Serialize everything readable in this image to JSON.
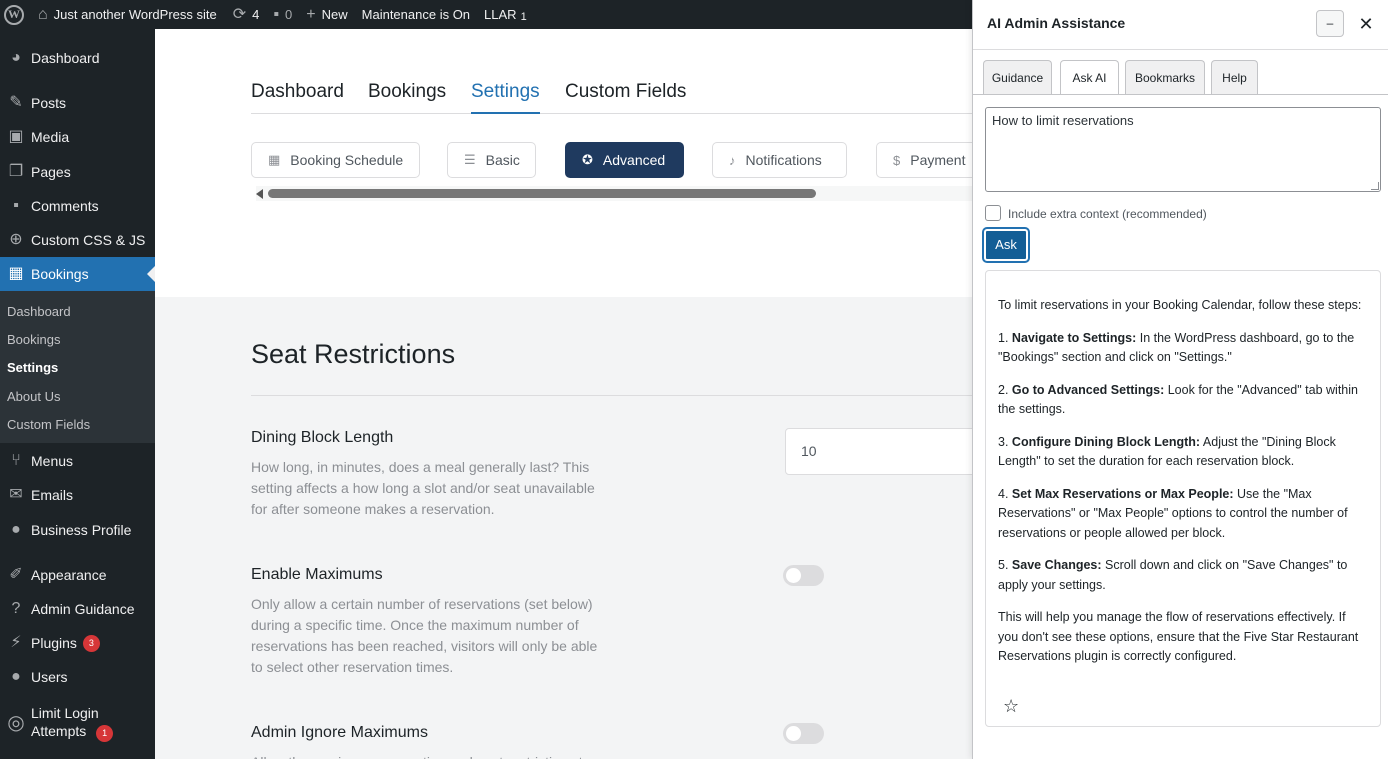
{
  "admin_bar": {
    "site_name": "Just another WordPress site",
    "updates_count": "4",
    "comments_count": "0",
    "new_label": "New",
    "maintenance_label": "Maintenance is On",
    "llar_label": "LLAR",
    "llar_count": "1"
  },
  "sidebar": {
    "items": [
      {
        "label": "Dashboard",
        "icon": "dashboard-icon"
      },
      {
        "label": "Posts",
        "icon": "pin-icon"
      },
      {
        "label": "Media",
        "icon": "media-icon"
      },
      {
        "label": "Pages",
        "icon": "pages-icon"
      },
      {
        "label": "Comments",
        "icon": "comments-icon"
      },
      {
        "label": "Custom CSS & JS",
        "icon": "plus-circle-icon"
      },
      {
        "label": "Bookings",
        "icon": "calendar-icon"
      },
      {
        "label": "Menus",
        "icon": "utensils-icon"
      },
      {
        "label": "Emails",
        "icon": "email-icon"
      },
      {
        "label": "Business Profile",
        "icon": "profile-icon"
      },
      {
        "label": "Appearance",
        "icon": "brush-icon"
      },
      {
        "label": "Admin Guidance",
        "icon": "question-icon"
      },
      {
        "label": "Plugins",
        "icon": "plug-icon",
        "badge": "3"
      },
      {
        "label": "Users",
        "icon": "users-icon"
      },
      {
        "label": "Limit Login Attempts",
        "icon": "fingerprint-icon",
        "badge": "1"
      }
    ],
    "submenu": [
      "Dashboard",
      "Bookings",
      "Settings",
      "About Us",
      "Custom Fields"
    ]
  },
  "main": {
    "nav_tabs": [
      "Dashboard",
      "Bookings",
      "Settings",
      "Custom Fields"
    ],
    "active_nav_tab": "Settings",
    "settings_tabs": [
      {
        "label": "Booking Schedule",
        "icon": "calendar-icon"
      },
      {
        "label": "Basic",
        "icon": "lines-icon"
      },
      {
        "label": "Advanced",
        "icon": "award-icon"
      },
      {
        "label": "Notifications",
        "icon": "bell-icon"
      },
      {
        "label": "Payment",
        "icon": "dollar-icon"
      }
    ],
    "active_settings_tab": "Advanced",
    "section_title": "Seat Restrictions",
    "options": [
      {
        "label": "Dining Block Length",
        "description": "How long, in minutes, does a meal generally last? This setting affects a how long a slot and/or seat unavailable for after someone makes a reservation.",
        "value": "10"
      },
      {
        "label": "Enable Maximums",
        "description": "Only allow a certain number of reservations (set below) during a specific time. Once the maximum number of reservations has been reached, visitors will only be able to select other reservation times.",
        "enabled": false
      },
      {
        "label": "Admin Ignore Maximums",
        "description": "Allow the maximum reservation and seat restrictions to",
        "enabled": false
      }
    ]
  },
  "ai_panel": {
    "title": "AI Admin Assistance",
    "minimize_label": "–",
    "close_label": "✕",
    "tabs": [
      "Guidance",
      "Ask AI",
      "Bookmarks",
      "Help"
    ],
    "active_tab": "Ask AI",
    "question": "How to limit reservations",
    "include_context_label": "Include extra context (recommended)",
    "include_context_checked": false,
    "ask_label": "Ask",
    "answer": {
      "intro": "To limit reservations in your Booking Calendar, follow these steps:",
      "steps": [
        {
          "num": "1.",
          "title": "Navigate to Settings:",
          "text": "In the WordPress dashboard, go to the \"Bookings\" section and click on \"Settings.\""
        },
        {
          "num": "2.",
          "title": "Go to Advanced Settings:",
          "text": "Look for the \"Advanced\" tab within the settings."
        },
        {
          "num": "3.",
          "title": "Configure Dining Block Length:",
          "text": "Adjust the \"Dining Block Length\" to set the duration for each reservation block."
        },
        {
          "num": "4.",
          "title": "Set Max Reservations or Max People:",
          "text": "Use the \"Max Reservations\" or \"Max People\" options to control the number of reservations or people allowed per block."
        },
        {
          "num": "5.",
          "title": "Save Changes:",
          "text": "Scroll down and click on \"Save Changes\" to apply your settings."
        }
      ],
      "outro": "This will help you manage the flow of reservations effectively. If you don't see these options, ensure that the Five Star Restaurant Reservations plugin is correctly configured."
    },
    "bookmark_icon": "star-icon"
  }
}
